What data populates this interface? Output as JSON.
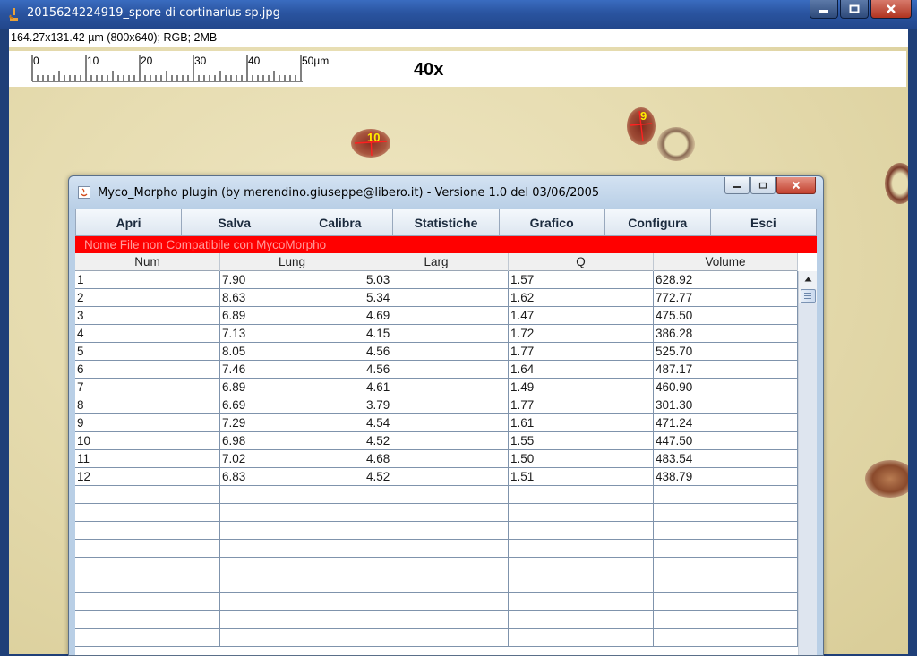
{
  "outer_window": {
    "title": "2015624224919_spore di cortinarius sp.jpg",
    "info": "164.27x131.42 µm (800x640); RGB; 2MB"
  },
  "scale_bar": {
    "ticks": [
      "0",
      "10",
      "20",
      "30",
      "40",
      "50µm"
    ],
    "magnification": "40x"
  },
  "spore_labels": [
    "10",
    "9"
  ],
  "plugin": {
    "title": "Myco_Morpho plugin (by merendino.giuseppe@libero.it) - Versione 1.0 del 03/06/2005",
    "buttons": [
      "Apri",
      "Salva",
      "Calibra",
      "Statistiche",
      "Grafico",
      "Configura",
      "Esci"
    ],
    "status": "Nome File non Compatibile con MycoMorpho",
    "columns": [
      "Num",
      "Lung",
      "Larg",
      "Q",
      "Volume"
    ],
    "rows": [
      [
        "1",
        "7.90",
        "5.03",
        "1.57",
        "628.92"
      ],
      [
        "2",
        "8.63",
        "5.34",
        "1.62",
        "772.77"
      ],
      [
        "3",
        "6.89",
        "4.69",
        "1.47",
        "475.50"
      ],
      [
        "4",
        "7.13",
        "4.15",
        "1.72",
        "386.28"
      ],
      [
        "5",
        "8.05",
        "4.56",
        "1.77",
        "525.70"
      ],
      [
        "6",
        "7.46",
        "4.56",
        "1.64",
        "487.17"
      ],
      [
        "7",
        "6.89",
        "4.61",
        "1.49",
        "460.90"
      ],
      [
        "8",
        "6.69",
        "3.79",
        "1.77",
        "301.30"
      ],
      [
        "9",
        "7.29",
        "4.54",
        "1.61",
        "471.24"
      ],
      [
        "10",
        "6.98",
        "4.52",
        "1.55",
        "447.50"
      ],
      [
        "11",
        "7.02",
        "4.68",
        "1.50",
        "483.54"
      ],
      [
        "12",
        "6.83",
        "4.52",
        "1.51",
        "438.79"
      ]
    ],
    "empty_rows": 9
  },
  "icons": {
    "outer_app": "microscope-icon",
    "plugin_app": "java-icon",
    "minimize": "minimize-icon",
    "maximize": "maximize-icon",
    "close": "close-icon",
    "scroll_up": "arrow-up-icon"
  },
  "colors": {
    "status_background": "#ff0000",
    "title_bar": "#2a54a0",
    "spore_label": "#ffee00"
  }
}
